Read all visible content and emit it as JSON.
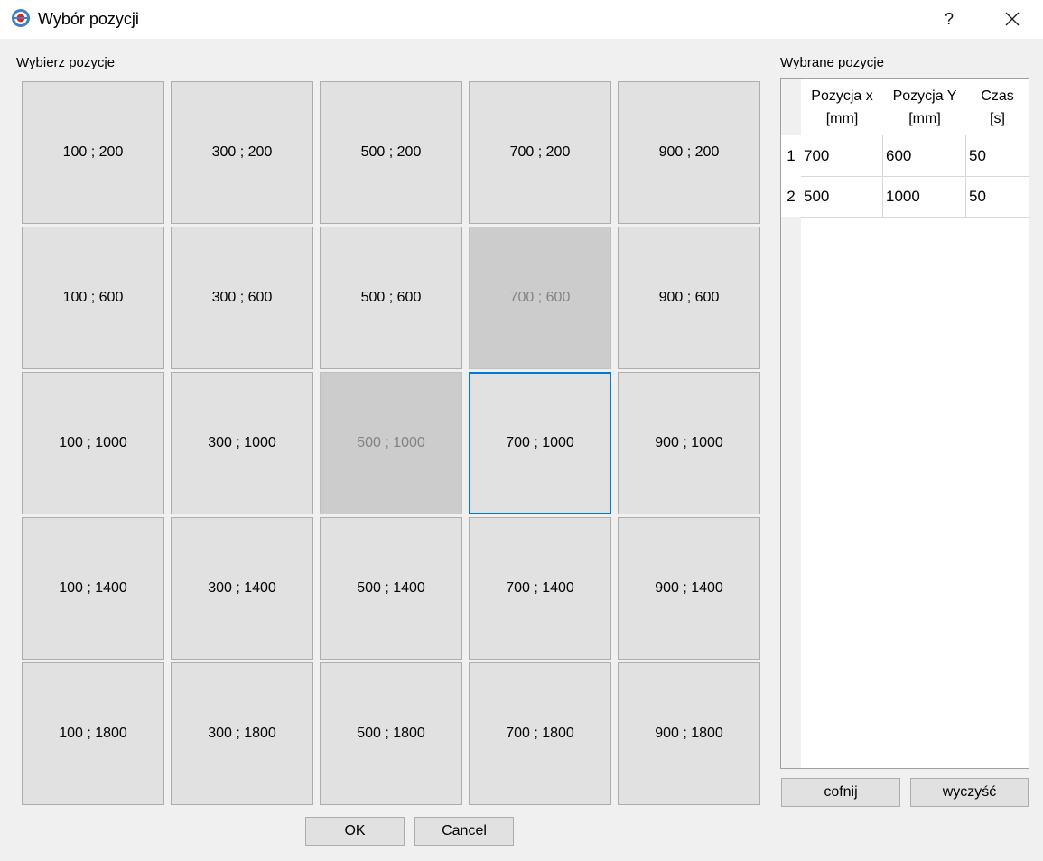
{
  "window": {
    "title": "Wybór pozycji",
    "help_label": "?"
  },
  "left_panel": {
    "label": "Wybierz pozycje",
    "positions": [
      "100 ; 200",
      "300 ; 200",
      "500 ; 200",
      "700 ; 200",
      "900 ; 200",
      "100 ; 600",
      "300 ; 600",
      "500 ; 600",
      "700 ; 600",
      "900 ; 600",
      "100 ; 1000",
      "300 ; 1000",
      "500 ; 1000",
      "700 ; 1000",
      "900 ; 1000",
      "100 ; 1400",
      "300 ; 1400",
      "500 ; 1400",
      "700 ; 1400",
      "900 ; 1400",
      "100 ; 1800",
      "300 ; 1800",
      "500 ; 1800",
      "700 ; 1800",
      "900 ; 1800"
    ],
    "disabled": [
      "700 ; 600",
      "500 ; 1000"
    ],
    "focused": "700 ; 1000"
  },
  "right_panel": {
    "label": "Wybrane pozycje",
    "columns": [
      {
        "line1": "Pozycja x",
        "line2": "[mm]"
      },
      {
        "line1": "Pozycja Y",
        "line2": "[mm]"
      },
      {
        "line1": "Czas",
        "line2": "[s]"
      }
    ],
    "rows": [
      {
        "index": "1",
        "x": "700",
        "y": "600",
        "t": "50"
      },
      {
        "index": "2",
        "x": "500",
        "y": "1000",
        "t": "50"
      }
    ],
    "undo_label": "cofnij",
    "clear_label": "wyczyść"
  },
  "buttons": {
    "ok_label": "OK",
    "cancel_label": "Cancel"
  },
  "colors": {
    "accent": "#0078d7",
    "button_bg": "#e1e1e1",
    "disabled_bg": "#cccccc",
    "disabled_text": "#838383"
  }
}
